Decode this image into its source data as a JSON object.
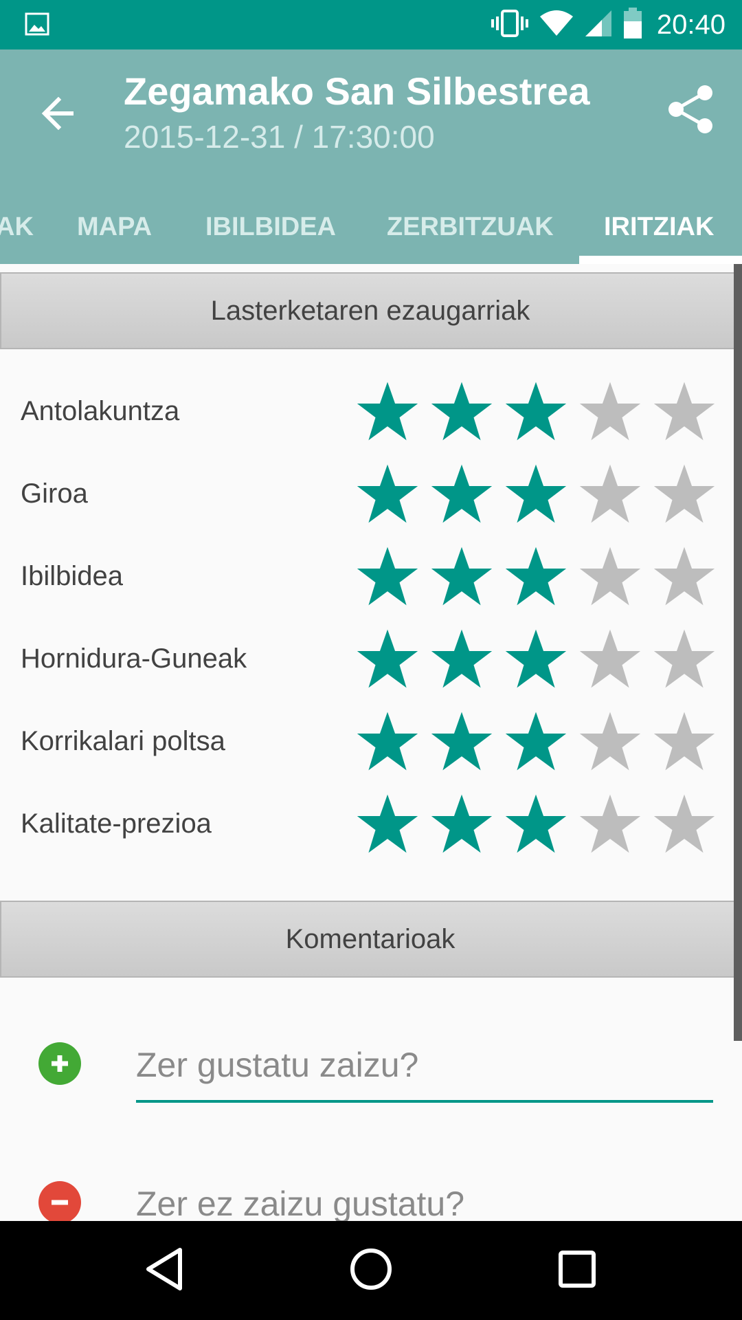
{
  "status_bar": {
    "time": "20:40"
  },
  "app_bar": {
    "title": "Zegamako San Silbestrea",
    "subtitle": "2015-12-31 / 17:30:00"
  },
  "tabs": [
    {
      "label": "AK",
      "active": false
    },
    {
      "label": "MAPA",
      "active": false
    },
    {
      "label": "IBILBIDEA",
      "active": false
    },
    {
      "label": "ZERBITZUAK",
      "active": false
    },
    {
      "label": "IRITZIAK",
      "active": true
    }
  ],
  "ratings_section": {
    "header": "Lasterketaren ezaugarriak",
    "max_stars": 5,
    "items": [
      {
        "label": "Antolakuntza",
        "stars": 3
      },
      {
        "label": "Giroa",
        "stars": 3
      },
      {
        "label": "Ibilbidea",
        "stars": 3
      },
      {
        "label": "Hornidura-Guneak",
        "stars": 3
      },
      {
        "label": "Korrikalari poltsa",
        "stars": 3
      },
      {
        "label": "Kalitate-prezioa",
        "stars": 3
      }
    ]
  },
  "comments_section": {
    "header": "Komentarioak",
    "positive_placeholder": "Zer gustatu zaizu?",
    "negative_placeholder": "Zer ez zaizu gustatu?"
  },
  "colors": {
    "status_bar": "#009688",
    "app_bar": "#7cb4b1",
    "star_filled": "#009688",
    "star_empty": "#bdbdbd",
    "positive_icon": "#43a935",
    "negative_icon": "#e2483a"
  },
  "icons": {
    "status_left": "image-icon",
    "status_right": [
      "vibrate-icon",
      "wifi-icon",
      "signal-icon",
      "battery-icon"
    ],
    "app_bar_left": "arrow-back-icon",
    "app_bar_right": "share-icon",
    "nav": [
      "back-triangle-icon",
      "home-circle-icon",
      "recents-square-icon"
    ]
  }
}
